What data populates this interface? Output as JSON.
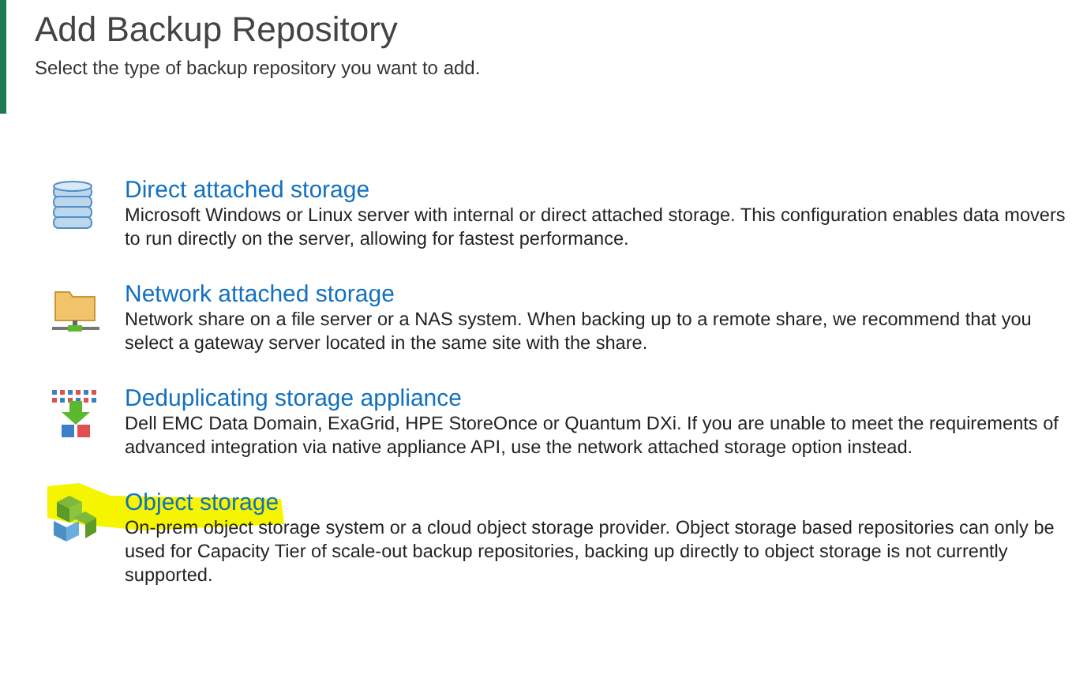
{
  "header": {
    "title": "Add Backup Repository",
    "subtitle": "Select the type of backup repository you want to add."
  },
  "options": [
    {
      "kind": "database",
      "title": "Direct attached storage",
      "description": "Microsoft Windows or Linux server with internal or direct attached storage. This configuration enables data movers to run directly on the server, allowing for fastest performance.",
      "highlighted": false
    },
    {
      "kind": "network",
      "title": "Network attached storage",
      "description": "Network share on a file server or a NAS system. When backing up to a remote share, we recommend that you select a gateway server located in the same site with the share.",
      "highlighted": false
    },
    {
      "kind": "dedup",
      "title": "Deduplicating storage appliance",
      "description": "Dell EMC Data Domain, ExaGrid, HPE StoreOnce or Quantum DXi. If you are unable to meet the requirements of advanced integration via native appliance API, use the network attached storage option instead.",
      "highlighted": false
    },
    {
      "kind": "object",
      "title": "Object storage",
      "description": "On-prem object storage system or a cloud object storage provider. Object storage based repositories can only be used for Capacity Tier of scale-out backup repositories, backing up directly to object storage is not currently supported.",
      "highlighted": true
    }
  ]
}
